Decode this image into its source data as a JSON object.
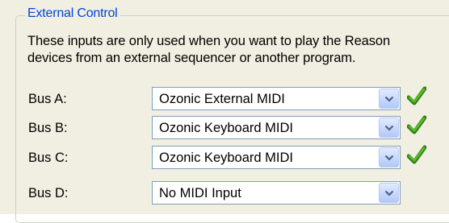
{
  "group": {
    "title": "External Control",
    "description_line1": "These inputs are only used when you want to play the Reason",
    "description_line2": "devices from an external sequencer or another program."
  },
  "buses": [
    {
      "label": "Bus A:",
      "value": "Ozonic External MIDI",
      "status_icon": "checkmark-icon",
      "status_color": "#3f9a1e"
    },
    {
      "label": "Bus B:",
      "value": "Ozonic Keyboard MIDI",
      "status_icon": "checkmark-icon",
      "status_color": "#3f9a1e"
    },
    {
      "label": "Bus C:",
      "value": "Ozonic Keyboard MIDI",
      "status_icon": "checkmark-icon",
      "status_color": "#3f9a1e"
    },
    {
      "label": "Bus D:",
      "value": "No MIDI Input",
      "status_icon": "",
      "status_color": ""
    }
  ],
  "colors": {
    "panel_bg": "#f1efe2",
    "title": "#0046d5",
    "combo_border": "#7f9db9"
  }
}
